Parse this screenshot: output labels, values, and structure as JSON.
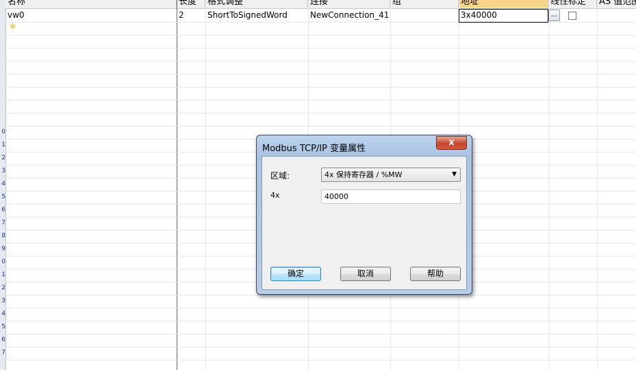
{
  "columns": {
    "name": "名称",
    "length": "长度",
    "format": "格式调整",
    "connection": "连接",
    "group": "组",
    "address": "地址",
    "linear_scaling": "线性标定",
    "as_value_range": "AS 值范围"
  },
  "row": {
    "name": "vw0",
    "length": "2",
    "format": "ShortToSignedWord",
    "connection": "NewConnection_41",
    "group": "",
    "address": "3x40000",
    "browse_label": "...",
    "linear_scaling_checked": false
  },
  "row_numbers": [
    "0",
    "1",
    "2",
    "3",
    "4",
    "5",
    "6",
    "7",
    "8",
    "9",
    "0",
    "1",
    "2",
    "3",
    "4",
    "5",
    "6",
    "7"
  ],
  "dialog": {
    "title": "Modbus TCP/IP 变量属性",
    "close_label": "x",
    "area_label": "区域:",
    "area_value": "4x 保持寄存器 / %MW",
    "offset_label": "4x",
    "offset_value": "40000",
    "ok_label": "确定",
    "cancel_label": "取消",
    "help_label": "帮助"
  },
  "colors": {
    "active_header": "#f7d48a",
    "dialog_frame": "#a9c3e2",
    "close_button": "#c7452b"
  }
}
